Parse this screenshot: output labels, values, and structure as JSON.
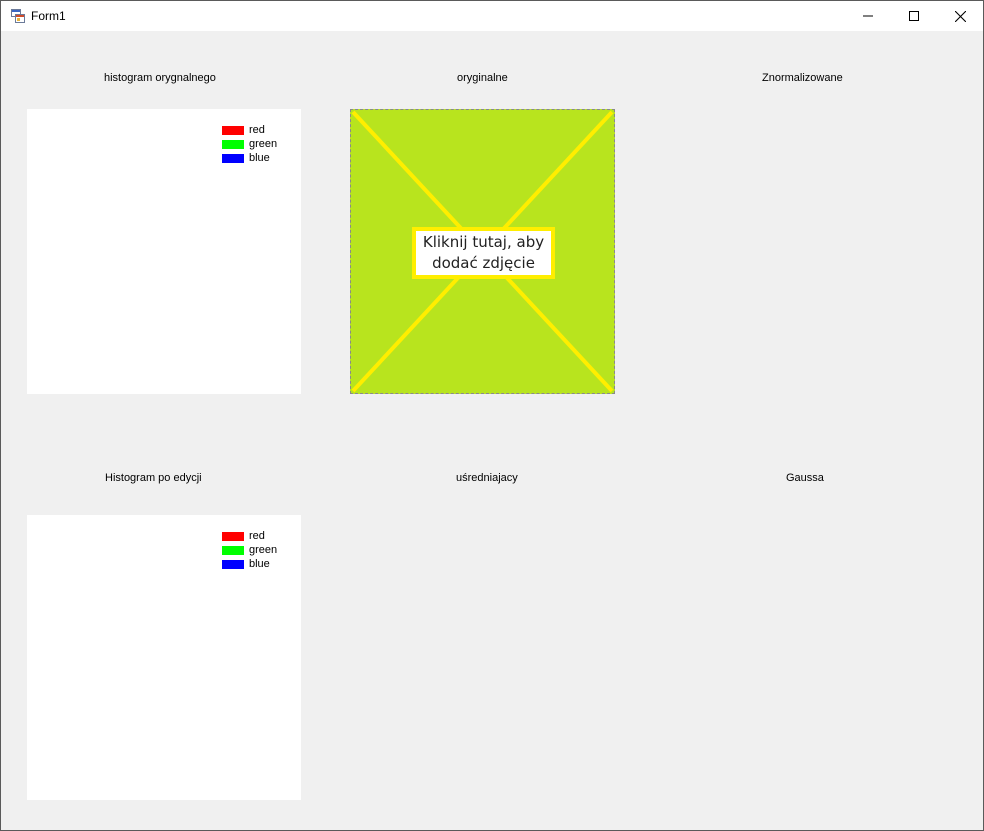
{
  "window": {
    "title": "Form1"
  },
  "labels": {
    "hist_original": "histogram orygnalnego",
    "original": "oryginalne",
    "normalized": "Znormalizowane",
    "hist_edited": "Histogram po edycji",
    "averaging": "uśredniajacy",
    "gauss": "Gaussa"
  },
  "legend": [
    {
      "label": "red",
      "color": "#ff0000"
    },
    {
      "label": "green",
      "color": "#00ff00"
    },
    {
      "label": "blue",
      "color": "#0000ff"
    }
  ],
  "picture": {
    "placeholder_text": "Kliknij tutaj, aby dodać zdjęcie",
    "fill_color": "#b8e41e",
    "accent_color": "#ffee00"
  }
}
